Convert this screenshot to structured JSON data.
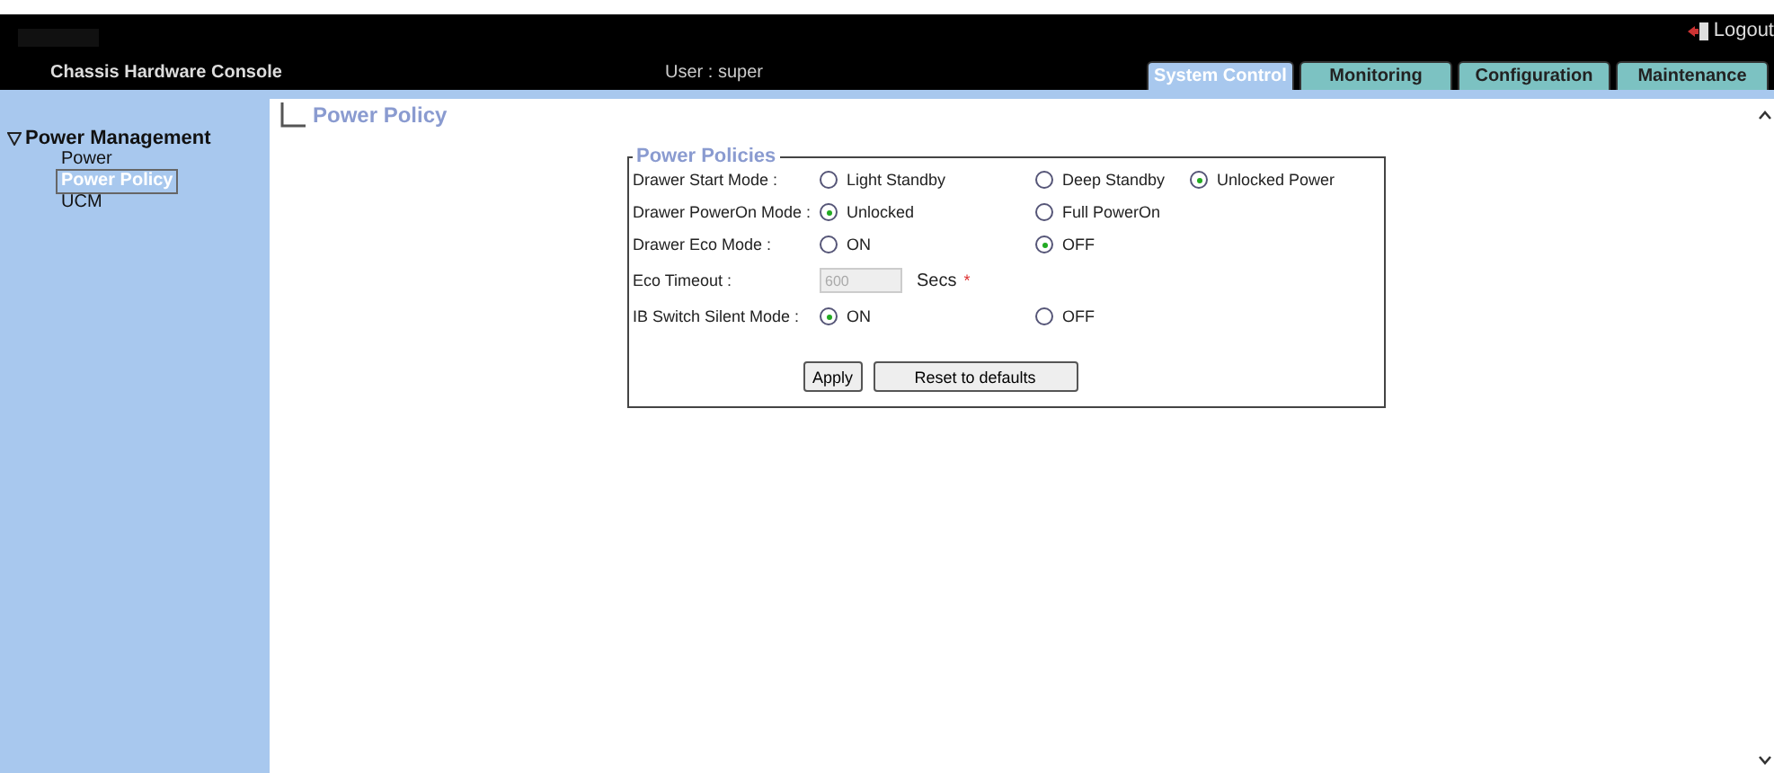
{
  "header": {
    "title": "Chassis Hardware Console",
    "user": "User : super",
    "logout": "Logout"
  },
  "tabs": [
    {
      "label": "System Control",
      "selected": true
    },
    {
      "label": "Monitoring",
      "selected": false
    },
    {
      "label": "Configuration",
      "selected": false
    },
    {
      "label": "Maintenance",
      "selected": false
    }
  ],
  "sidebar": {
    "group": {
      "label": "Power Management",
      "expanded": true,
      "children": [
        {
          "label": "Power",
          "selected": false
        },
        {
          "label": "Power Policy",
          "selected": true
        },
        {
          "label": "UCM",
          "selected": false
        }
      ]
    }
  },
  "page_title": "Power Policy",
  "fieldset": {
    "legend": "Power Policies",
    "rows": [
      {
        "kind": "radio",
        "label": "Drawer Start Mode :",
        "options": [
          {
            "label": "Light Standby",
            "selected": false
          },
          {
            "label": "Deep Standby",
            "selected": false
          },
          {
            "label": "Unlocked Power",
            "selected": true
          }
        ]
      },
      {
        "kind": "radio",
        "label": "Drawer PowerOn Mode :",
        "options": [
          {
            "label": "Unlocked",
            "selected": true
          },
          {
            "label": "Full PowerOn",
            "selected": false
          }
        ]
      },
      {
        "kind": "radio",
        "label": "Drawer Eco Mode :",
        "options": [
          {
            "label": "ON",
            "selected": false
          },
          {
            "label": "OFF",
            "selected": true
          }
        ]
      },
      {
        "kind": "field",
        "label": "Eco Timeout :",
        "value": "600",
        "disabled": true,
        "unit": "Secs",
        "required_mark": "*"
      },
      {
        "kind": "radio",
        "label": "IB Switch Silent Mode :",
        "options": [
          {
            "label": "ON",
            "selected": true
          },
          {
            "label": "OFF",
            "selected": false
          }
        ]
      }
    ],
    "buttons": [
      "Apply",
      "Reset to defaults"
    ]
  }
}
